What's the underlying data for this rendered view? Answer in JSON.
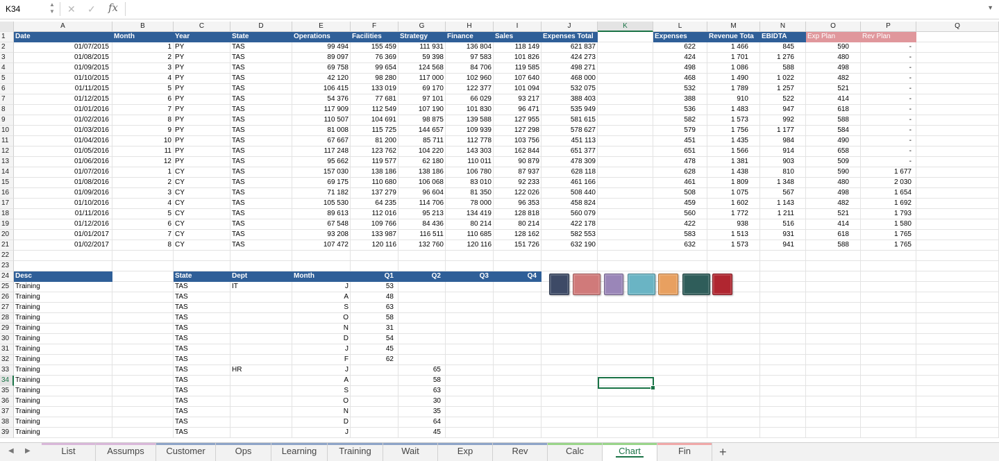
{
  "formula_bar": {
    "name_box": "K34",
    "cancel_icon": "close-icon",
    "enter_icon": "checkmark-icon",
    "fx_label": "fx",
    "formula": ""
  },
  "columns": [
    "A",
    "B",
    "C",
    "D",
    "E",
    "F",
    "G",
    "H",
    "I",
    "J",
    "K",
    "L",
    "M",
    "N",
    "O",
    "P",
    "Q"
  ],
  "selected_column": "K",
  "selected_row": 34,
  "row_numbers": [
    1,
    2,
    3,
    4,
    5,
    6,
    7,
    8,
    9,
    10,
    11,
    12,
    13,
    14,
    15,
    16,
    17,
    18,
    19,
    20,
    21,
    22,
    23,
    24,
    25,
    26,
    27,
    28,
    29,
    30,
    31,
    32,
    33,
    34,
    35,
    36,
    37,
    38,
    39
  ],
  "table1": {
    "headers": [
      "Date",
      "Month",
      "Year",
      "State",
      "Operations",
      "Facilities",
      "Strategy",
      "Finance",
      "Sales",
      "Expenses Total"
    ],
    "rows": [
      [
        "01/07/2015",
        "1",
        "PY",
        "TAS",
        "99 494",
        "155 459",
        "111 931",
        "136 804",
        "118 149",
        "621 837"
      ],
      [
        "01/08/2015",
        "2",
        "PY",
        "TAS",
        "89 097",
        "76 369",
        "59 398",
        "97 583",
        "101 826",
        "424 273"
      ],
      [
        "01/09/2015",
        "3",
        "PY",
        "TAS",
        "69 758",
        "99 654",
        "124 568",
        "84 706",
        "119 585",
        "498 271"
      ],
      [
        "01/10/2015",
        "4",
        "PY",
        "TAS",
        "42 120",
        "98 280",
        "117 000",
        "102 960",
        "107 640",
        "468 000"
      ],
      [
        "01/11/2015",
        "5",
        "PY",
        "TAS",
        "106 415",
        "133 019",
        "69 170",
        "122 377",
        "101 094",
        "532 075"
      ],
      [
        "01/12/2015",
        "6",
        "PY",
        "TAS",
        "54 376",
        "77 681",
        "97 101",
        "66 029",
        "93 217",
        "388 403"
      ],
      [
        "01/01/2016",
        "7",
        "PY",
        "TAS",
        "117 909",
        "112 549",
        "107 190",
        "101 830",
        "96 471",
        "535 949"
      ],
      [
        "01/02/2016",
        "8",
        "PY",
        "TAS",
        "110 507",
        "104 691",
        "98 875",
        "139 588",
        "127 955",
        "581 615"
      ],
      [
        "01/03/2016",
        "9",
        "PY",
        "TAS",
        "81 008",
        "115 725",
        "144 657",
        "109 939",
        "127 298",
        "578 627"
      ],
      [
        "01/04/2016",
        "10",
        "PY",
        "TAS",
        "67 667",
        "81 200",
        "85 711",
        "112 778",
        "103 756",
        "451 113"
      ],
      [
        "01/05/2016",
        "11",
        "PY",
        "TAS",
        "117 248",
        "123 762",
        "104 220",
        "143 303",
        "162 844",
        "651 377"
      ],
      [
        "01/06/2016",
        "12",
        "PY",
        "TAS",
        "95 662",
        "119 577",
        "62 180",
        "110 011",
        "90 879",
        "478 309"
      ],
      [
        "01/07/2016",
        "1",
        "CY",
        "TAS",
        "157 030",
        "138 186",
        "138 186",
        "106 780",
        "87 937",
        "628 118"
      ],
      [
        "01/08/2016",
        "2",
        "CY",
        "TAS",
        "69 175",
        "110 680",
        "106 068",
        "83 010",
        "92 233",
        "461 166"
      ],
      [
        "01/09/2016",
        "3",
        "CY",
        "TAS",
        "71 182",
        "137 279",
        "96 604",
        "81 350",
        "122 026",
        "508 440"
      ],
      [
        "01/10/2016",
        "4",
        "CY",
        "TAS",
        "105 530",
        "64 235",
        "114 706",
        "78 000",
        "96 353",
        "458 824"
      ],
      [
        "01/11/2016",
        "5",
        "CY",
        "TAS",
        "89 613",
        "112 016",
        "95 213",
        "134 419",
        "128 818",
        "560 079"
      ],
      [
        "01/12/2016",
        "6",
        "CY",
        "TAS",
        "67 548",
        "109 766",
        "84 436",
        "80 214",
        "80 214",
        "422 178"
      ],
      [
        "01/01/2017",
        "7",
        "CY",
        "TAS",
        "93 208",
        "133 987",
        "116 511",
        "110 685",
        "128 162",
        "582 553"
      ],
      [
        "01/02/2017",
        "8",
        "CY",
        "TAS",
        "107 472",
        "120 116",
        "132 760",
        "120 116",
        "151 726",
        "632 190"
      ]
    ]
  },
  "table2": {
    "headers": [
      "Expenses",
      "Revenue Tota",
      "EBIDTA",
      "Exp Plan",
      "Rev Plan"
    ],
    "rows": [
      [
        "622",
        "1 466",
        "845",
        "590",
        "-"
      ],
      [
        "424",
        "1 701",
        "1 276",
        "480",
        "-"
      ],
      [
        "498",
        "1 086",
        "588",
        "498",
        "-"
      ],
      [
        "468",
        "1 490",
        "1 022",
        "482",
        "-"
      ],
      [
        "532",
        "1 789",
        "1 257",
        "521",
        "-"
      ],
      [
        "388",
        "910",
        "522",
        "414",
        "-"
      ],
      [
        "536",
        "1 483",
        "947",
        "618",
        "-"
      ],
      [
        "582",
        "1 573",
        "992",
        "588",
        "-"
      ],
      [
        "579",
        "1 756",
        "1 177",
        "584",
        "-"
      ],
      [
        "451",
        "1 435",
        "984",
        "490",
        "-"
      ],
      [
        "651",
        "1 566",
        "914",
        "658",
        "-"
      ],
      [
        "478",
        "1 381",
        "903",
        "509",
        "-"
      ],
      [
        "628",
        "1 438",
        "810",
        "590",
        "1 677"
      ],
      [
        "461",
        "1 809",
        "1 348",
        "480",
        "2 030"
      ],
      [
        "508",
        "1 075",
        "567",
        "498",
        "1 654"
      ],
      [
        "459",
        "1 602",
        "1 143",
        "482",
        "1 692"
      ],
      [
        "560",
        "1 772",
        "1 211",
        "521",
        "1 793"
      ],
      [
        "422",
        "938",
        "516",
        "414",
        "1 580"
      ],
      [
        "583",
        "1 513",
        "931",
        "618",
        "1 765"
      ],
      [
        "632",
        "1 573",
        "941",
        "588",
        "1 765"
      ]
    ]
  },
  "table3": {
    "headers": [
      "Desc",
      "State",
      "Dept",
      "Month",
      "Q1",
      "Q2",
      "Q3",
      "Q4"
    ],
    "rows": [
      [
        "Training",
        "TAS",
        "IT",
        "J",
        "53",
        ""
      ],
      [
        "Training",
        "TAS",
        "",
        "A",
        "48",
        ""
      ],
      [
        "Training",
        "TAS",
        "",
        "S",
        "63",
        ""
      ],
      [
        "Training",
        "TAS",
        "",
        "O",
        "58",
        ""
      ],
      [
        "Training",
        "TAS",
        "",
        "N",
        "31",
        ""
      ],
      [
        "Training",
        "TAS",
        "",
        "D",
        "54",
        ""
      ],
      [
        "Training",
        "TAS",
        "",
        "J",
        "45",
        ""
      ],
      [
        "Training",
        "TAS",
        "",
        "F",
        "62",
        ""
      ],
      [
        "Training",
        "TAS",
        "HR",
        "J",
        "",
        "65"
      ],
      [
        "Training",
        "TAS",
        "",
        "A",
        "",
        "58"
      ],
      [
        "Training",
        "TAS",
        "",
        "S",
        "",
        "63"
      ],
      [
        "Training",
        "TAS",
        "",
        "O",
        "",
        "30"
      ],
      [
        "Training",
        "TAS",
        "",
        "N",
        "",
        "35"
      ],
      [
        "Training",
        "TAS",
        "",
        "D",
        "",
        "64"
      ],
      [
        "Training",
        "TAS",
        "",
        "J",
        "",
        "45"
      ]
    ]
  },
  "swatches": [
    "#3d4a66",
    "#d07a7a",
    "#9a86b8",
    "#6ab4c4",
    "#e8a060",
    "#2f5d5a",
    "#b02630"
  ],
  "sheet_tabs": [
    {
      "label": "List",
      "color": "#d9b8d9"
    },
    {
      "label": "Assumps",
      "color": "#d9b8d9"
    },
    {
      "label": "Customer",
      "color": "#8ea4c8"
    },
    {
      "label": "Ops",
      "color": "#8ea4c8"
    },
    {
      "label": "Learning",
      "color": "#8ea4c8"
    },
    {
      "label": "Training",
      "color": "#8ea4c8"
    },
    {
      "label": "Wait",
      "color": "#8ea4c8"
    },
    {
      "label": "Exp",
      "color": "#8ea4c8"
    },
    {
      "label": "Rev",
      "color": "#8ea4c8"
    },
    {
      "label": "Calc",
      "color": "#9ad58a"
    },
    {
      "label": "Chart",
      "color": "#9ad58a"
    },
    {
      "label": "Fin",
      "color": "#f0a8a8"
    }
  ],
  "active_tab": "Chart",
  "add_sheet_label": "+"
}
